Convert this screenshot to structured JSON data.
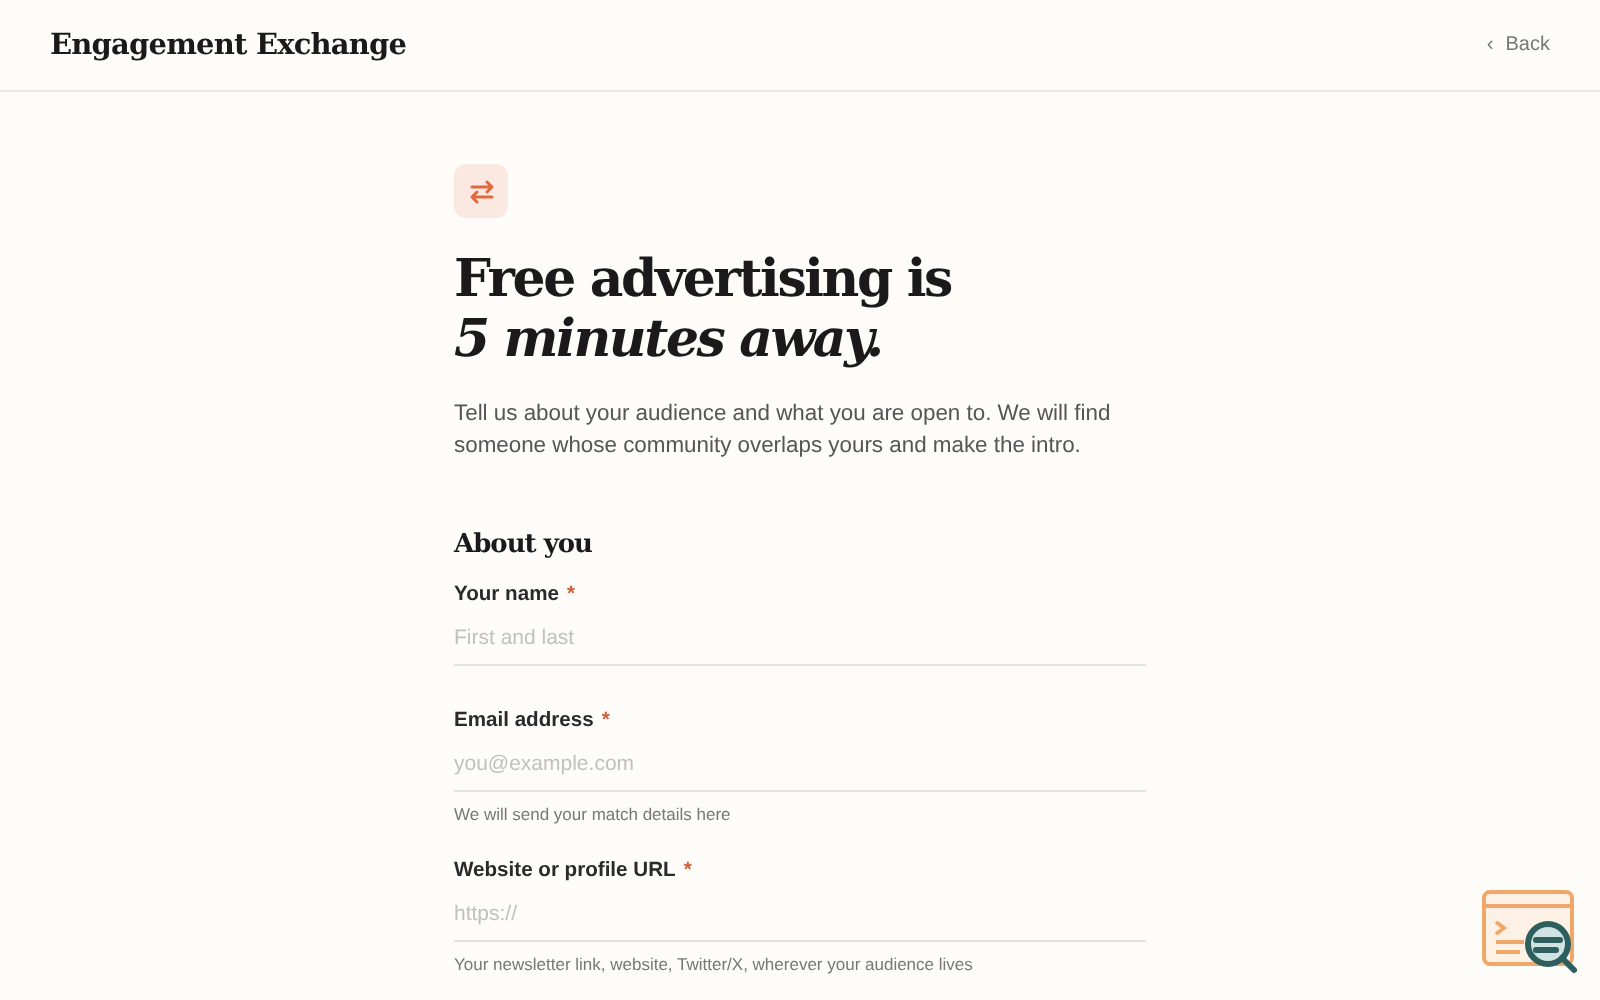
{
  "header": {
    "brand": "Engagement Exchange",
    "back": {
      "icon": "‹",
      "label": "Back"
    }
  },
  "hero": {
    "title": "Free advertising is *5 minutes away.*",
    "intro": "Tell us about your audience and what you are open to. We will find someone whose community overlaps yours and make the intro."
  },
  "section": {
    "title": "About you",
    "fields": [
      {
        "label": "Your name",
        "required_mark": "*",
        "placeholder": "First and last"
      },
      {
        "label": "Email address",
        "required_mark": "*",
        "placeholder": "you@example.com",
        "hint": "We will send your match details here"
      },
      {
        "label": "Website or profile URL",
        "required_mark": "*",
        "placeholder": "https://",
        "hint": "Your newsletter link, website, Twitter/X, wherever your audience lives"
      }
    ]
  }
}
